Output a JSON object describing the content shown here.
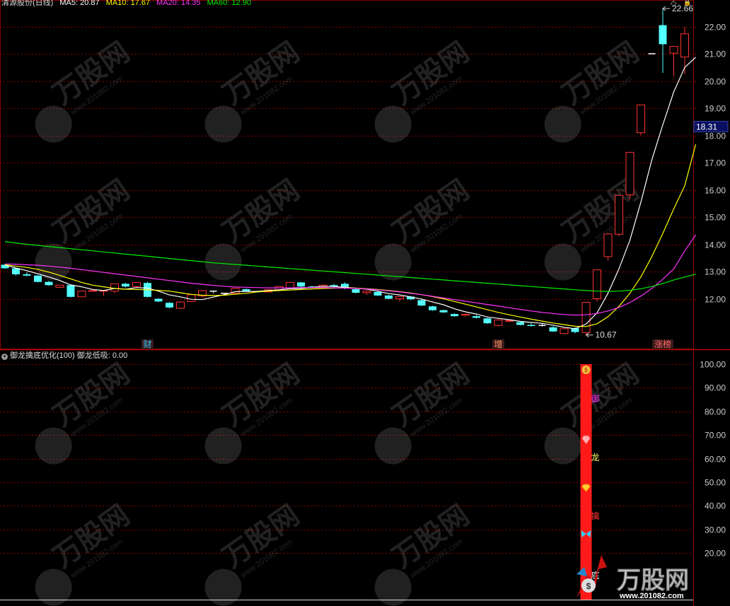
{
  "main_panel": {
    "title": "清源股份(日线)",
    "ma": [
      {
        "label": "MA5: 20.87",
        "color": "#ffffff"
      },
      {
        "label": "MA10: 17.67",
        "color": "#ffff00"
      },
      {
        "label": "MA20: 14.35",
        "color": "#ff33ff"
      },
      {
        "label": "MA60: 12.90",
        "color": "#00ee00"
      }
    ],
    "price_marker": "18.31",
    "high_label": "22.66",
    "low_label": "10.67",
    "event_labels": [
      {
        "text": "财",
        "color": "#33ccff",
        "index": 13
      },
      {
        "text": "增",
        "color": "#ff9966",
        "index": 45
      },
      {
        "text": "涨榜",
        "color": "#ff6666",
        "index": 60
      }
    ],
    "window_icons": {
      "diamond": "◇",
      "lock": "🔒"
    }
  },
  "sub_panel": {
    "title": "御龙擒底优化(100)  御龙低吸: 0.00",
    "tags": [
      "御",
      "龙",
      "擒",
      "底"
    ],
    "icons": [
      "money-bag-icon",
      "gem-icon",
      "diamond-icon",
      "butterfly-icon"
    ]
  },
  "watermark": {
    "brand": "万股网",
    "url": "www.201082.com"
  },
  "colors": {
    "up": "#ff3333",
    "down": "#54ffff",
    "grid": "#8b0000",
    "axis_text": "#cccccc",
    "bar": "#ff1a1a"
  },
  "chart_data": [
    {
      "type": "candlestick",
      "title": "清源股份(日线)",
      "ylim": [
        10.2,
        22.9
      ],
      "yticks": [
        12.0,
        13.0,
        14.0,
        15.0,
        16.0,
        17.0,
        18.0,
        19.0,
        20.0,
        21.0,
        22.0
      ],
      "ytick_labels": [
        "12.00",
        "13.00",
        "14.00",
        "15.00",
        "16.00",
        "17.00",
        "18.00",
        "19.00",
        "20.00",
        "21.00",
        "22.00"
      ],
      "ohlc": [
        [
          13.25,
          13.28,
          13.1,
          13.12
        ],
        [
          13.12,
          13.14,
          12.85,
          12.9
        ],
        [
          12.9,
          12.98,
          12.82,
          12.85
        ],
        [
          12.85,
          12.88,
          12.6,
          12.62
        ],
        [
          12.62,
          12.66,
          12.48,
          12.5
        ],
        [
          12.42,
          12.5,
          12.4,
          12.5
        ],
        [
          12.5,
          12.52,
          12.05,
          12.07
        ],
        [
          12.07,
          12.3,
          12.05,
          12.28
        ],
        [
          12.28,
          12.34,
          12.28,
          12.3
        ],
        [
          12.28,
          12.32,
          12.1,
          12.3
        ],
        [
          12.28,
          12.55,
          12.2,
          12.55
        ],
        [
          12.55,
          12.58,
          12.42,
          12.45
        ],
        [
          12.45,
          12.6,
          12.4,
          12.6
        ],
        [
          12.58,
          12.62,
          12.05,
          12.07
        ],
        [
          12.0,
          12.02,
          11.88,
          11.9
        ],
        [
          11.85,
          11.88,
          11.65,
          11.68
        ],
        [
          11.65,
          11.9,
          11.62,
          11.88
        ],
        [
          11.9,
          12.15,
          11.88,
          12.15
        ],
        [
          12.1,
          12.32,
          12.05,
          12.3
        ],
        [
          12.28,
          12.3,
          12.2,
          12.28
        ],
        [
          12.2,
          12.22,
          12.18,
          12.2
        ],
        [
          12.2,
          12.4,
          12.18,
          12.38
        ],
        [
          12.35,
          12.38,
          12.25,
          12.28
        ],
        [
          12.28,
          12.3,
          12.24,
          12.25
        ],
        [
          12.25,
          12.35,
          12.24,
          12.33
        ],
        [
          12.33,
          12.45,
          12.28,
          12.45
        ],
        [
          12.4,
          12.62,
          12.38,
          12.6
        ],
        [
          12.6,
          12.62,
          12.43,
          12.45
        ],
        [
          12.45,
          12.48,
          12.38,
          12.42
        ],
        [
          12.42,
          12.52,
          12.38,
          12.5
        ],
        [
          12.5,
          12.55,
          12.42,
          12.45
        ],
        [
          12.55,
          12.6,
          12.35,
          12.38
        ],
        [
          12.35,
          12.38,
          12.2,
          12.22
        ],
        [
          12.22,
          12.3,
          12.15,
          12.28
        ],
        [
          12.25,
          12.28,
          12.1,
          12.12
        ],
        [
          12.12,
          12.15,
          11.98,
          12.0
        ],
        [
          12.0,
          12.1,
          11.9,
          12.08
        ],
        [
          12.08,
          12.1,
          11.95,
          11.98
        ],
        [
          11.95,
          11.98,
          11.73,
          11.75
        ],
        [
          11.72,
          11.74,
          11.56,
          11.58
        ],
        [
          11.58,
          11.6,
          11.48,
          11.5
        ],
        [
          11.44,
          11.46,
          11.34,
          11.36
        ],
        [
          11.4,
          11.45,
          11.35,
          11.43
        ],
        [
          11.36,
          11.4,
          11.28,
          11.3
        ],
        [
          11.28,
          11.3,
          11.08,
          11.1
        ],
        [
          11.02,
          11.25,
          10.98,
          11.22
        ],
        [
          11.18,
          11.24,
          11.14,
          11.2
        ],
        [
          11.14,
          11.17,
          11.02,
          11.04
        ],
        [
          11.04,
          11.1,
          10.98,
          11.0
        ],
        [
          11.02,
          11.09,
          10.98,
          11.02
        ],
        [
          10.95,
          11.0,
          10.78,
          10.8
        ],
        [
          10.72,
          10.92,
          10.69,
          10.9
        ],
        [
          10.92,
          10.95,
          10.73,
          10.78
        ],
        [
          10.76,
          11.87,
          10.67,
          11.87
        ],
        [
          12.0,
          13.06,
          11.9,
          13.06
        ],
        [
          13.55,
          14.38,
          13.4,
          14.38
        ],
        [
          14.37,
          15.8,
          14.3,
          15.8
        ],
        [
          15.82,
          17.38,
          15.65,
          17.38
        ],
        [
          18.1,
          19.12,
          18.0,
          19.12
        ],
        [
          21.0,
          21.0,
          21.0,
          21.0
        ],
        [
          22.05,
          22.66,
          20.3,
          21.35
        ],
        [
          21.02,
          21.27,
          20.18,
          21.27
        ],
        [
          20.88,
          21.98,
          20.25,
          21.73
        ]
      ],
      "series": [
        {
          "name": "MA5",
          "color": "#ffffff",
          "values": [
            13.24,
            13.13,
            13.03,
            12.92,
            12.8,
            12.67,
            12.51,
            12.44,
            12.34,
            12.3,
            12.38,
            12.35,
            12.41,
            12.39,
            12.28,
            12.14,
            12.07,
            11.98,
            11.97,
            12.06,
            12.15,
            12.26,
            12.27,
            12.27,
            12.3,
            12.33,
            12.37,
            12.38,
            12.42,
            12.46,
            12.45,
            12.42,
            12.39,
            12.35,
            12.28,
            12.19,
            12.14,
            12.07,
            11.99,
            11.88,
            11.78,
            11.63,
            11.52,
            11.44,
            11.33,
            11.28,
            11.23,
            11.17,
            11.13,
            11.1,
            11.03,
            10.95,
            10.9,
            11.07,
            11.48,
            12.2,
            13.1,
            14.15,
            15.55,
            17.1,
            18.39,
            19.6,
            20.5,
            20.87
          ]
        },
        {
          "name": "MA10",
          "color": "#ffff00",
          "values": [
            13.25,
            13.2,
            13.15,
            13.08,
            12.98,
            12.86,
            12.73,
            12.6,
            12.5,
            12.44,
            12.38,
            12.35,
            12.34,
            12.33,
            12.31,
            12.28,
            12.22,
            12.16,
            12.13,
            12.12,
            12.13,
            12.17,
            12.2,
            12.25,
            12.28,
            12.3,
            12.32,
            12.34,
            12.36,
            12.38,
            12.39,
            12.4,
            12.39,
            12.37,
            12.34,
            12.3,
            12.26,
            12.21,
            12.15,
            12.08,
            12.0,
            11.9,
            11.8,
            11.7,
            11.6,
            11.5,
            11.41,
            11.33,
            11.25,
            11.18,
            11.11,
            11.05,
            10.99,
            10.98,
            11.08,
            11.34,
            11.72,
            12.2,
            12.8,
            13.55,
            14.4,
            15.3,
            16.15,
            17.67
          ]
        },
        {
          "name": "MA20",
          "color": "#ff33ff",
          "values": [
            13.28,
            13.27,
            13.25,
            13.23,
            13.2,
            13.16,
            13.12,
            13.07,
            13.02,
            12.97,
            12.92,
            12.87,
            12.82,
            12.77,
            12.72,
            12.67,
            12.62,
            12.57,
            12.53,
            12.49,
            12.46,
            12.43,
            12.42,
            12.41,
            12.4,
            12.4,
            12.4,
            12.41,
            12.41,
            12.41,
            12.4,
            12.39,
            12.38,
            12.36,
            12.33,
            12.29,
            12.25,
            12.2,
            12.15,
            12.09,
            12.03,
            11.97,
            11.91,
            11.85,
            11.79,
            11.73,
            11.67,
            11.61,
            11.55,
            11.5,
            11.46,
            11.42,
            11.4,
            11.41,
            11.46,
            11.55,
            11.68,
            11.86,
            12.1,
            12.38,
            12.72,
            13.1,
            13.75,
            14.35
          ]
        },
        {
          "name": "MA60",
          "color": "#00ee00",
          "values": [
            14.1,
            14.05,
            14.0,
            13.96,
            13.92,
            13.88,
            13.84,
            13.8,
            13.76,
            13.72,
            13.68,
            13.64,
            13.6,
            13.56,
            13.52,
            13.48,
            13.44,
            13.4,
            13.36,
            13.32,
            13.29,
            13.26,
            13.23,
            13.2,
            13.17,
            13.14,
            13.11,
            13.08,
            13.05,
            13.02,
            12.99,
            12.96,
            12.93,
            12.9,
            12.87,
            12.84,
            12.81,
            12.78,
            12.75,
            12.72,
            12.69,
            12.66,
            12.63,
            12.6,
            12.57,
            12.54,
            12.51,
            12.48,
            12.45,
            12.42,
            12.39,
            12.36,
            12.33,
            12.3,
            12.28,
            12.27,
            12.28,
            12.31,
            12.37,
            12.45,
            12.56,
            12.69,
            12.8,
            12.9
          ]
        }
      ]
    },
    {
      "type": "bar",
      "title": "御龙擒底优化(100)",
      "ylim": [
        0,
        105
      ],
      "yticks": [
        20,
        30,
        40,
        50,
        60,
        70,
        80,
        90,
        100
      ],
      "ytick_labels": [
        "20.00",
        "30.00",
        "40.00",
        "50.00",
        "60.00",
        "70.00",
        "80.00",
        "90.00",
        "100.00"
      ],
      "series": [
        {
          "name": "御龙低吸",
          "bar_index": 53,
          "value": 100
        }
      ]
    }
  ]
}
